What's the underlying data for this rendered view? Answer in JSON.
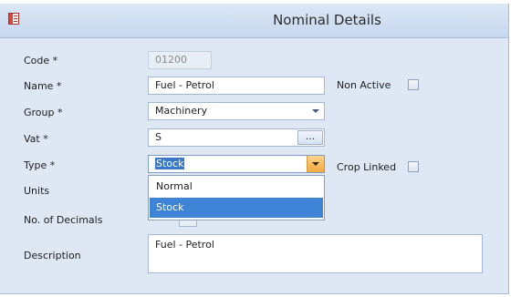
{
  "window": {
    "title": "Nominal Details"
  },
  "form": {
    "code": {
      "label": "Code *",
      "value": "01200"
    },
    "name": {
      "label": "Name *",
      "value": "Fuel - Petrol"
    },
    "non_active": {
      "label": "Non Active",
      "checked": false
    },
    "group": {
      "label": "Group *",
      "value": "Machinery"
    },
    "vat": {
      "label": "Vat *",
      "value": "S",
      "button": "..."
    },
    "type": {
      "label": "Type *",
      "value": "Stock",
      "options": [
        "Normal",
        "Stock"
      ],
      "selected_option": "Stock"
    },
    "crop_linked": {
      "label": "Crop Linked",
      "checked": false
    },
    "units": {
      "label": "Units"
    },
    "decimals": {
      "label": "No. of Decimals"
    },
    "description": {
      "label": "Description",
      "value": "Fuel - Petrol"
    }
  },
  "colors": {
    "window_bg": "#dde8f4",
    "selection": "#3d83d6",
    "dropdown_hot": "#f3a73c"
  },
  "icons": {
    "title_icon": "form-icon",
    "dropdown_arrow": "chevron-down-icon"
  }
}
